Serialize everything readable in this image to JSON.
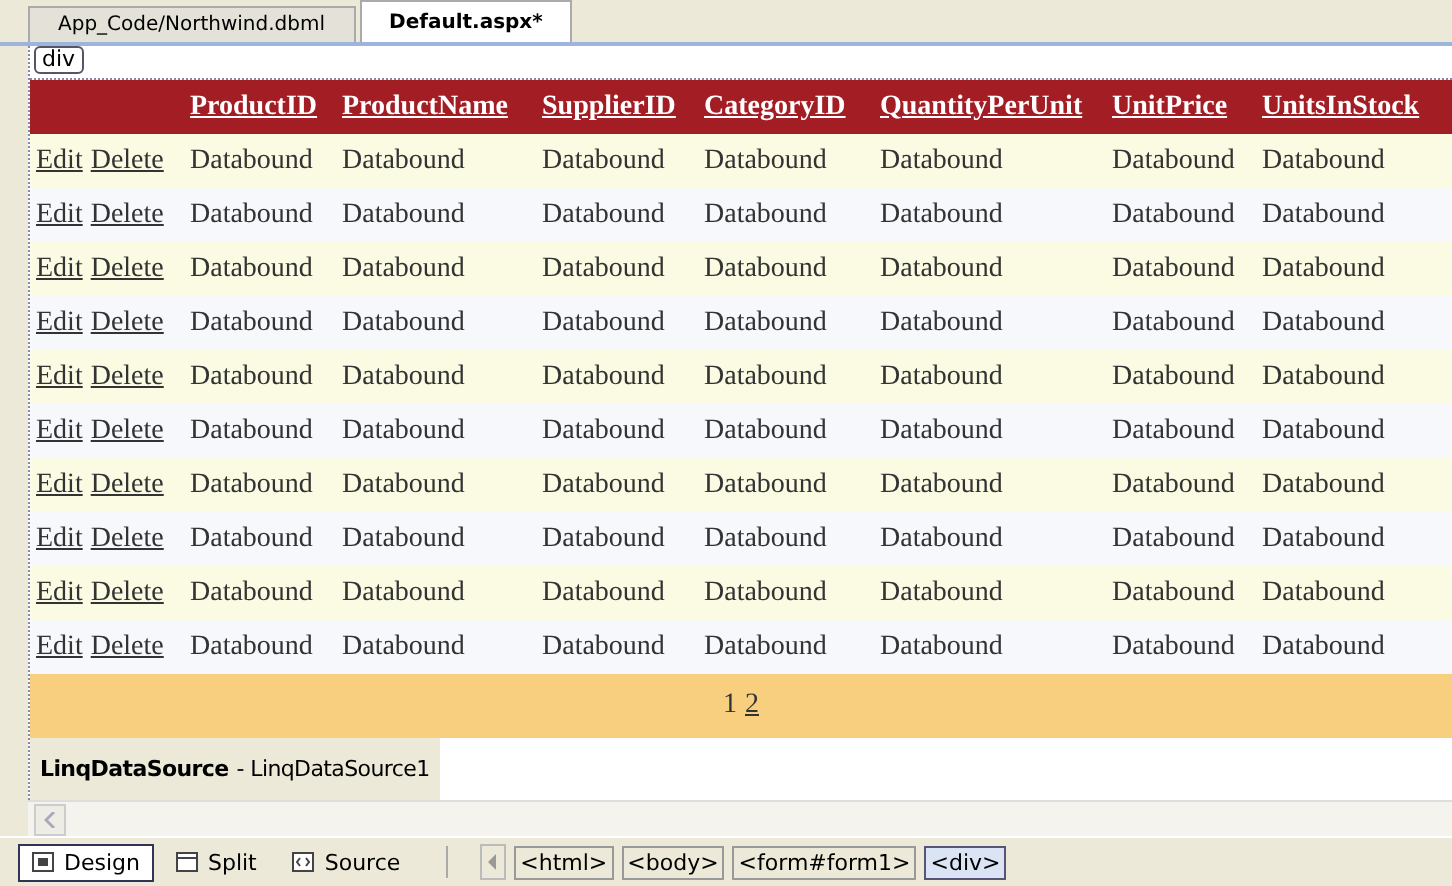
{
  "tabs": [
    {
      "label": "App_Code/Northwind.dbml",
      "selected": false
    },
    {
      "label": "Default.aspx*",
      "selected": true
    }
  ],
  "element_tag": "div",
  "grid": {
    "columns": [
      "ProductID",
      "ProductName",
      "SupplierID",
      "CategoryID",
      "QuantityPerUnit",
      "UnitPrice",
      "UnitsInStock"
    ],
    "rows": [
      {
        "actions": [
          "Edit",
          "Delete"
        ],
        "cells": [
          "Databound",
          "Databound",
          "Databound",
          "Databound",
          "Databound",
          "Databound",
          "Databound"
        ]
      },
      {
        "actions": [
          "Edit",
          "Delete"
        ],
        "cells": [
          "Databound",
          "Databound",
          "Databound",
          "Databound",
          "Databound",
          "Databound",
          "Databound"
        ]
      },
      {
        "actions": [
          "Edit",
          "Delete"
        ],
        "cells": [
          "Databound",
          "Databound",
          "Databound",
          "Databound",
          "Databound",
          "Databound",
          "Databound"
        ]
      },
      {
        "actions": [
          "Edit",
          "Delete"
        ],
        "cells": [
          "Databound",
          "Databound",
          "Databound",
          "Databound",
          "Databound",
          "Databound",
          "Databound"
        ]
      },
      {
        "actions": [
          "Edit",
          "Delete"
        ],
        "cells": [
          "Databound",
          "Databound",
          "Databound",
          "Databound",
          "Databound",
          "Databound",
          "Databound"
        ]
      },
      {
        "actions": [
          "Edit",
          "Delete"
        ],
        "cells": [
          "Databound",
          "Databound",
          "Databound",
          "Databound",
          "Databound",
          "Databound",
          "Databound"
        ]
      },
      {
        "actions": [
          "Edit",
          "Delete"
        ],
        "cells": [
          "Databound",
          "Databound",
          "Databound",
          "Databound",
          "Databound",
          "Databound",
          "Databound"
        ]
      },
      {
        "actions": [
          "Edit",
          "Delete"
        ],
        "cells": [
          "Databound",
          "Databound",
          "Databound",
          "Databound",
          "Databound",
          "Databound",
          "Databound"
        ]
      },
      {
        "actions": [
          "Edit",
          "Delete"
        ],
        "cells": [
          "Databound",
          "Databound",
          "Databound",
          "Databound",
          "Databound",
          "Databound",
          "Databound"
        ]
      },
      {
        "actions": [
          "Edit",
          "Delete"
        ],
        "cells": [
          "Databound",
          "Databound",
          "Databound",
          "Databound",
          "Databound",
          "Databound",
          "Databound"
        ]
      }
    ],
    "pager": [
      {
        "label": "1",
        "selected": true
      },
      {
        "label": "2",
        "selected": false
      }
    ]
  },
  "data_source": {
    "type": "LinqDataSource",
    "name": "- LinqDataSource1"
  },
  "views": [
    {
      "label": "Design",
      "selected": true
    },
    {
      "label": "Split",
      "selected": false
    },
    {
      "label": "Source",
      "selected": false
    }
  ],
  "breadcrumb": [
    {
      "label": "<html>",
      "selected": false
    },
    {
      "label": "<body>",
      "selected": false
    },
    {
      "label": "<form#form1>",
      "selected": false
    },
    {
      "label": "<div>",
      "selected": true
    }
  ]
}
